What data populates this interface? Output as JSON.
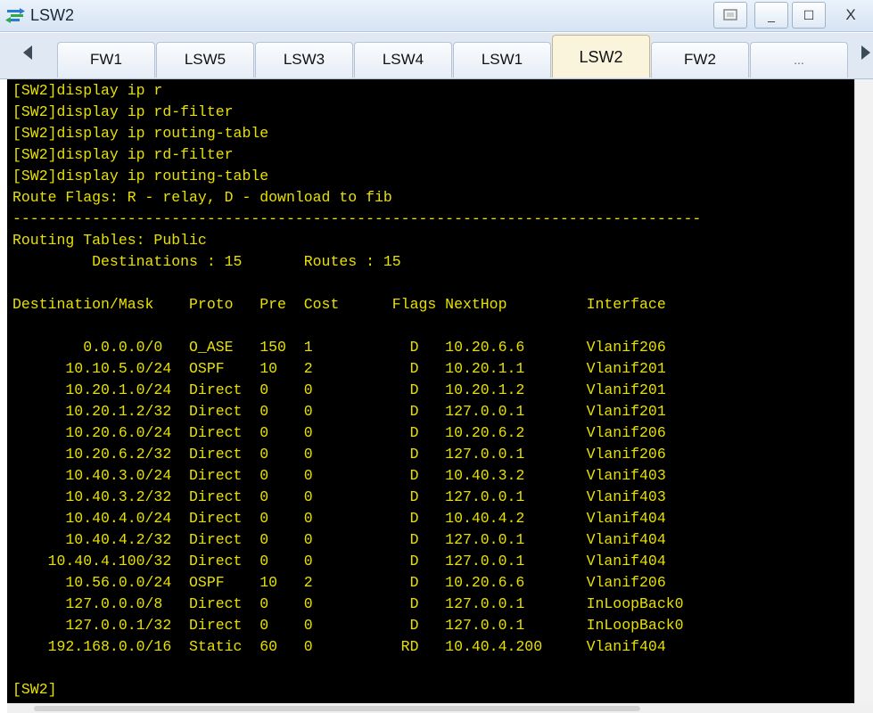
{
  "window": {
    "title": "LSW2",
    "controls": {
      "minimize": "_",
      "maximize": "☐",
      "close": "X"
    }
  },
  "tabs": [
    {
      "label": "FW1",
      "active": false
    },
    {
      "label": "LSW5",
      "active": false
    },
    {
      "label": "LSW3",
      "active": false
    },
    {
      "label": "LSW4",
      "active": false
    },
    {
      "label": "LSW1",
      "active": false
    },
    {
      "label": "LSW2",
      "active": true
    },
    {
      "label": "FW2",
      "active": false
    },
    {
      "label": "...",
      "active": false
    }
  ],
  "colors": {
    "terminal_bg": "#000000",
    "terminal_text": "#e8e000",
    "active_tab": "#fbf4dd"
  },
  "terminal": {
    "commands": [
      "[SW2]display ip r",
      "[SW2]display ip rd-filter",
      "[SW2]display ip routing-table",
      "[SW2]display ip rd-filter",
      "[SW2]display ip routing-table"
    ],
    "route_flags": "Route Flags: R - relay, D - download to fib",
    "separator": "------------------------------------------------------------------------------",
    "table_title": "Routing Tables: Public",
    "summary": "         Destinations : 15       Routes : 15",
    "header": "Destination/Mask    Proto   Pre  Cost      Flags NextHop         Interface",
    "routes": [
      "        0.0.0.0/0   O_ASE   150  1           D   10.20.6.6       Vlanif206",
      "      10.10.5.0/24  OSPF    10   2           D   10.20.1.1       Vlanif201",
      "      10.20.1.0/24  Direct  0    0           D   10.20.1.2       Vlanif201",
      "      10.20.1.2/32  Direct  0    0           D   127.0.0.1       Vlanif201",
      "      10.20.6.0/24  Direct  0    0           D   10.20.6.2       Vlanif206",
      "      10.20.6.2/32  Direct  0    0           D   127.0.0.1       Vlanif206",
      "      10.40.3.0/24  Direct  0    0           D   10.40.3.2       Vlanif403",
      "      10.40.3.2/32  Direct  0    0           D   127.0.0.1       Vlanif403",
      "      10.40.4.0/24  Direct  0    0           D   10.40.4.2       Vlanif404",
      "      10.40.4.2/32  Direct  0    0           D   127.0.0.1       Vlanif404",
      "    10.40.4.100/32  Direct  0    0           D   127.0.0.1       Vlanif404",
      "      10.56.0.0/24  OSPF    10   2           D   10.20.6.6       Vlanif206",
      "      127.0.0.0/8   Direct  0    0           D   127.0.0.1       InLoopBack0",
      "      127.0.0.1/32  Direct  0    0           D   127.0.0.1       InLoopBack0",
      "    192.168.0.0/16  Static  60   0          RD   10.40.4.200     Vlanif404"
    ],
    "prompt": "[SW2]"
  }
}
